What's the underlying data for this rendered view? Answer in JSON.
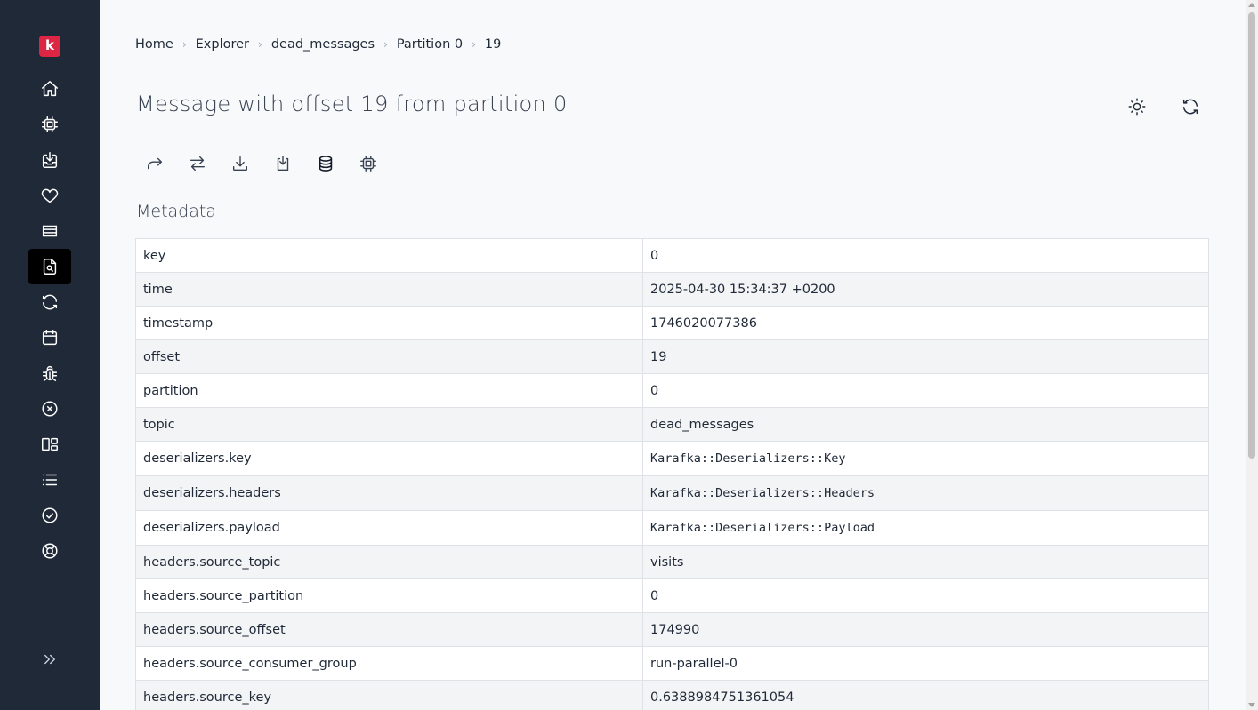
{
  "app": {
    "logo_letter": "k",
    "brand_color": "#dc2644",
    "sidebar_bg": "#1f2937"
  },
  "sidebar": {
    "items": [
      {
        "icon": "home-icon",
        "active": false
      },
      {
        "icon": "cpu-chip-icon",
        "active": false
      },
      {
        "icon": "inbox-download-icon",
        "active": false
      },
      {
        "icon": "heart-icon",
        "active": false
      },
      {
        "icon": "stack-icon",
        "active": false
      },
      {
        "icon": "document-search-icon",
        "active": true
      },
      {
        "icon": "refresh-icon",
        "active": false
      },
      {
        "icon": "calendar-icon",
        "active": false
      },
      {
        "icon": "bug-icon",
        "active": false
      },
      {
        "icon": "x-circle-icon",
        "active": false
      },
      {
        "icon": "dashboard-icon",
        "active": false
      },
      {
        "icon": "list-icon",
        "active": false
      },
      {
        "icon": "check-badge-icon",
        "active": false
      },
      {
        "icon": "lifebuoy-icon",
        "active": false
      }
    ],
    "collapse_icon": "chevron-double-right-icon"
  },
  "breadcrumb": [
    "Home",
    "Explorer",
    "dead_messages",
    "Partition 0",
    "19"
  ],
  "page": {
    "title": "Message with offset 19 from partition 0"
  },
  "top_actions": [
    "sun-icon",
    "refresh-icon"
  ],
  "toolbar": [
    "republish-icon",
    "switch-icon",
    "download-icon",
    "export-icon",
    "database-icon",
    "cpu-chip-icon"
  ],
  "metadata": {
    "title": "Metadata",
    "rows": [
      {
        "key": "key",
        "value": "0",
        "mono": false
      },
      {
        "key": "time",
        "value": "2025-04-30 15:34:37 +0200",
        "mono": false
      },
      {
        "key": "timestamp",
        "value": "1746020077386",
        "mono": false
      },
      {
        "key": "offset",
        "value": "19",
        "mono": false
      },
      {
        "key": "partition",
        "value": "0",
        "mono": false
      },
      {
        "key": "topic",
        "value": "dead_messages",
        "mono": false
      },
      {
        "key": "deserializers.key",
        "value": "Karafka::Deserializers::Key",
        "mono": true
      },
      {
        "key": "deserializers.headers",
        "value": "Karafka::Deserializers::Headers",
        "mono": true
      },
      {
        "key": "deserializers.payload",
        "value": "Karafka::Deserializers::Payload",
        "mono": true
      },
      {
        "key": "headers.source_topic",
        "value": "visits",
        "mono": false
      },
      {
        "key": "headers.source_partition",
        "value": "0",
        "mono": false
      },
      {
        "key": "headers.source_offset",
        "value": "174990",
        "mono": false
      },
      {
        "key": "headers.source_consumer_group",
        "value": "run-parallel-0",
        "mono": false
      },
      {
        "key": "headers.source_key",
        "value": "0.6388984751361054",
        "mono": false
      }
    ]
  }
}
